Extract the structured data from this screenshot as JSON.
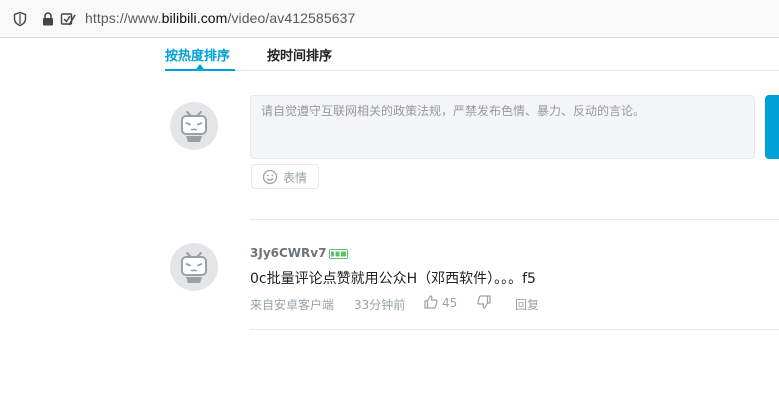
{
  "browser": {
    "url_prefix": "https://www.",
    "url_domain": "bilibili.com",
    "url_path": "/video/av412585637"
  },
  "sort_tabs": {
    "hot": "按热度排序",
    "time": "按时间排序"
  },
  "composer": {
    "placeholder": "请自觉遵守互联网相关的政策法规，严禁发布色情、暴力、反动的言论。",
    "emoji_label": "表情"
  },
  "comments": [
    {
      "username": "3Jy6CWRv7",
      "level_icon": "level-2-badge",
      "text": "0c批量评论点赞就用公众H（邓西软件）。。。f5",
      "source": "来自安卓客户端",
      "time": "33分钟前",
      "likes": "45",
      "reply_label": "回复"
    }
  ],
  "colors": {
    "accent": "#00a1d6",
    "level_green": "#5fbf6f"
  }
}
